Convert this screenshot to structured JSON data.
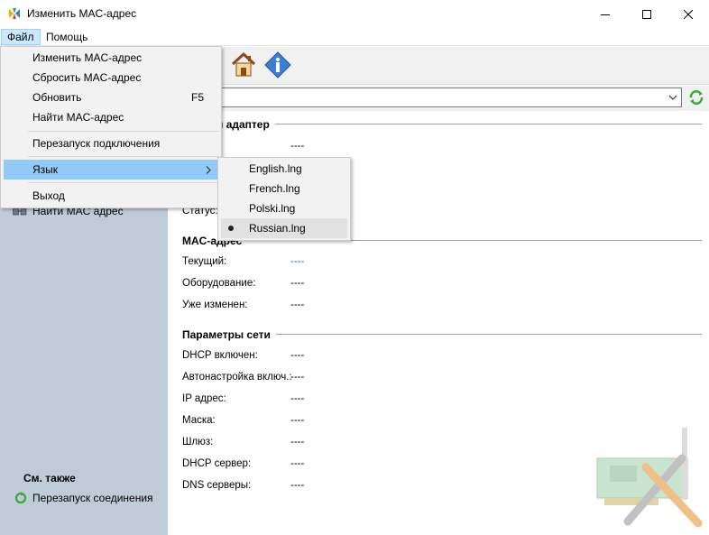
{
  "window": {
    "title": "Изменить MAC-адрес"
  },
  "menubar": {
    "file": "Файл",
    "help": "Помощь"
  },
  "file_menu": {
    "items": [
      {
        "label": "Изменить MAC-адрес",
        "shortcut": ""
      },
      {
        "label": "Сбросить MAC-адрес",
        "shortcut": ""
      },
      {
        "label": "Обновить",
        "shortcut": "F5"
      },
      {
        "label": "Найти MAC-адрес",
        "shortcut": ""
      },
      {
        "label": "Перезапуск подключения",
        "shortcut": ""
      },
      {
        "label": "Язык",
        "shortcut": ""
      },
      {
        "label": "Выход",
        "shortcut": ""
      }
    ],
    "highlighted": "Язык"
  },
  "language_menu": {
    "items": [
      "English.lng",
      "French.lng",
      "Polski.lng",
      "Russian.lng"
    ],
    "selected": "Russian.lng"
  },
  "left_panel": {
    "find_mac": "Найти MAC адрес",
    "see_also": "См. также",
    "restart_connection": "Перезапуск соединения"
  },
  "adapter": {
    "title_partial": "й адаптер",
    "first_value": "----",
    "status_label": "Статус:",
    "status_value": ""
  },
  "mac": {
    "title": "MAC-адрес",
    "current_label": "Текущий:",
    "current_value": "----",
    "hardware_label": "Оборудование:",
    "hardware_value": "----",
    "changed_label": "Уже изменен:",
    "changed_value": "----"
  },
  "network": {
    "title": "Параметры сети",
    "fields": [
      {
        "label": "DHCP включен:",
        "value": "----"
      },
      {
        "label": "Автонастройка включ.:",
        "value": "----"
      },
      {
        "label": "IP адрес:",
        "value": "----"
      },
      {
        "label": "Маска:",
        "value": "----"
      },
      {
        "label": "Шлюз:",
        "value": "----"
      },
      {
        "label": "DHCP сервер:",
        "value": "----"
      },
      {
        "label": "DNS серверы:",
        "value": "----"
      }
    ]
  },
  "colors": {
    "left_panel": "#bfcbd7",
    "menu_highlight": "#91c9f7",
    "accent_green": "#3aa83a"
  }
}
